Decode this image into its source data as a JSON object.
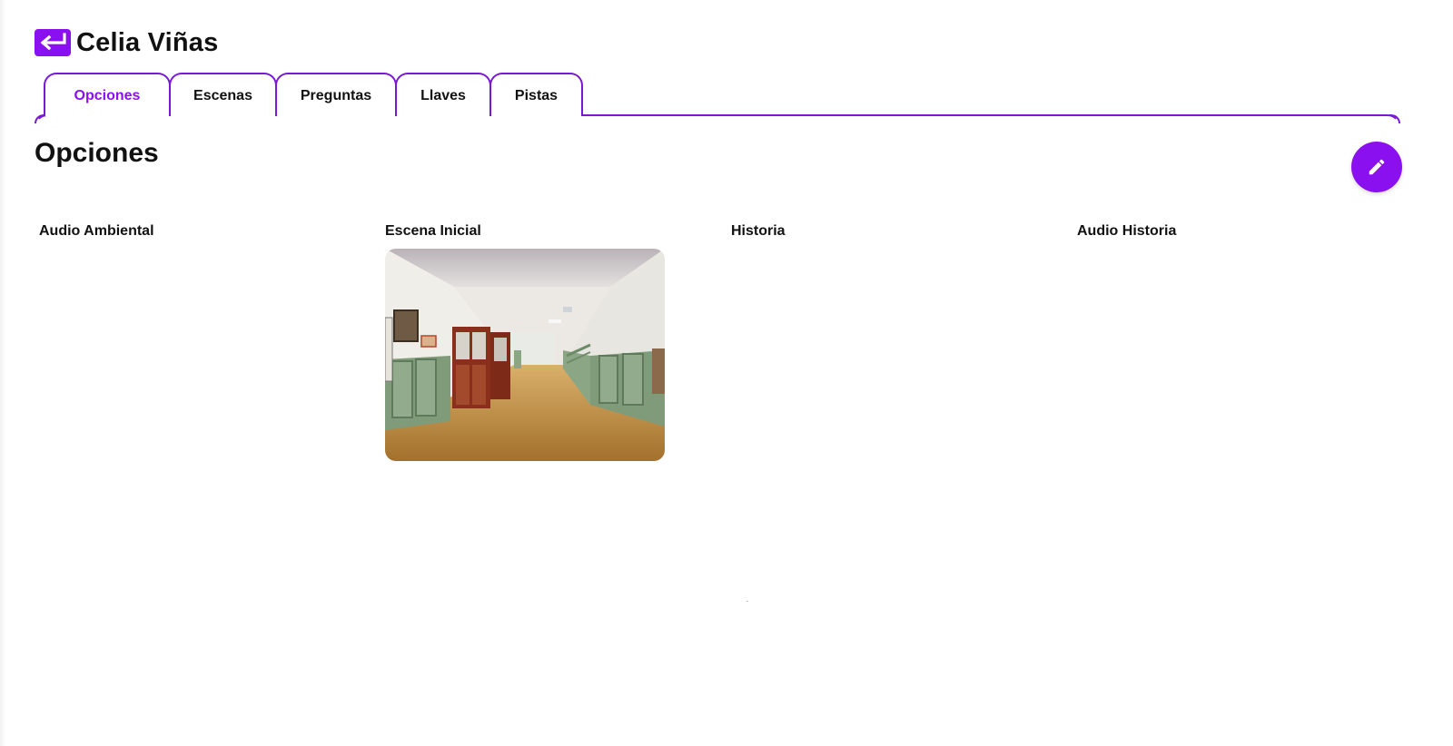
{
  "header": {
    "back_icon": "return-arrow-icon",
    "title": "Celia Viñas"
  },
  "tabs": [
    {
      "label": "Opciones",
      "active": true
    },
    {
      "label": "Escenas",
      "active": false
    },
    {
      "label": "Preguntas",
      "active": false
    },
    {
      "label": "Llaves",
      "active": false
    },
    {
      "label": "Pistas",
      "active": false
    }
  ],
  "section": {
    "title": "Opciones",
    "edit_icon": "pencil-icon"
  },
  "options": [
    {
      "label": "Audio Ambiental"
    },
    {
      "label": "Escena Inicial"
    },
    {
      "label": "Historia"
    },
    {
      "label": "Audio Historia"
    }
  ],
  "colors": {
    "accent": "#8b10f0",
    "tab_border": "#7a18d6"
  }
}
